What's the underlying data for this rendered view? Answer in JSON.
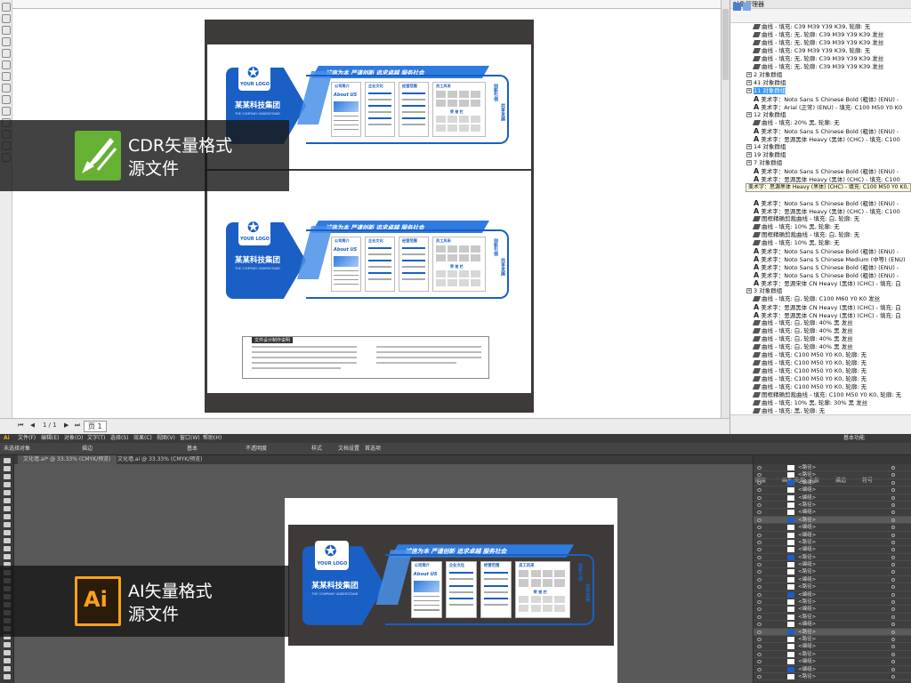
{
  "cdr": {
    "panel_title": "对象管理器",
    "page_tab": "页 1",
    "page_counter": "1 / 1",
    "tooltip": "美术字：思源黑体 Heavy (黑体) (CHC) - 填充: C100 M50 Y0 K0, 轮...",
    "tree": [
      {
        "t": "曲线 - 填充: C39 M39 Y39 K39, 轮廓: 无",
        "k": "curve"
      },
      {
        "t": "曲线 - 填充: 无, 轮廓: C39 M39 Y39 K39 发丝",
        "k": "curve"
      },
      {
        "t": "曲线 - 填充: 无, 轮廓: C39 M39 Y39 K39 发丝",
        "k": "curve"
      },
      {
        "t": "曲线 - 填充: C39 M39 Y39 K39, 轮廓: 无",
        "k": "curve"
      },
      {
        "t": "曲线 - 填充: 无, 轮廓: C39 M39 Y39 K39 发丝",
        "k": "curve"
      },
      {
        "t": "曲线 - 填充: 无, 轮廓: C39 M39 Y39 K39 发丝",
        "k": "curve"
      },
      {
        "t": "2 对象群组",
        "k": "group"
      },
      {
        "t": "41 对象群组",
        "k": "group"
      },
      {
        "t": "11 对象群组",
        "k": "group",
        "sel": true
      },
      {
        "t": "美术字：Noto Sans S Chinese Bold (粗体) (ENU) -",
        "k": "text"
      },
      {
        "t": "美术字：Arial (正常) (ENU) - 填充: C100 M50 Y0 K0",
        "k": "text"
      },
      {
        "t": "12 对象群组",
        "k": "group"
      },
      {
        "t": "曲线 - 填充: 20% 黑, 轮廓: 无",
        "k": "curve"
      },
      {
        "t": "美术字：Noto Sans S Chinese Bold (粗体) (ENU) -",
        "k": "text"
      },
      {
        "t": "美术字：思源黑体 Heavy (黑体) (CHC) - 填充: C100",
        "k": "text"
      },
      {
        "t": "14 对象群组",
        "k": "group"
      },
      {
        "t": "19 对象群组",
        "k": "group"
      },
      {
        "t": "7 对象群组",
        "k": "group"
      },
      {
        "t": "美术字：Noto Sans S Chinese Bold (粗体) (ENU) -",
        "k": "text"
      },
      {
        "t": "美术字：思源黑体 Heavy (黑体) (CHC) - 填充: C100",
        "k": "text"
      },
      {
        "t": "美术字：Noto Sans S Chinese Bold (粗体) (ENU) -",
        "k": "text"
      },
      {
        "t": "",
        "k": "tooltip"
      },
      {
        "t": "美术字：Noto Sans S Chinese Bold (粗体) (ENU) -",
        "k": "text"
      },
      {
        "t": "美术字：思源黑体 Heavy (黑体) (CHC) - 填充: C100",
        "k": "text"
      },
      {
        "t": "图框精确剪裁曲线 - 填充: 白, 轮廓: 无",
        "k": "curve"
      },
      {
        "t": "曲线 - 填充: 10% 黑, 轮廓: 无",
        "k": "curve"
      },
      {
        "t": "图框精确剪裁曲线 - 填充: 白, 轮廓: 无",
        "k": "curve"
      },
      {
        "t": "曲线 - 填充: 10% 黑, 轮廓: 无",
        "k": "curve"
      },
      {
        "t": "美术字：Noto Sans S Chinese Bold (粗体) (ENU) -",
        "k": "text"
      },
      {
        "t": "美术字：Noto Sans S Chinese Medium (中等) (ENU)",
        "k": "text"
      },
      {
        "t": "美术字：Noto Sans S Chinese Bold (粗体) (ENU) -",
        "k": "text"
      },
      {
        "t": "美术字：Noto Sans S Chinese Bold (粗体) (ENU) -",
        "k": "text"
      },
      {
        "t": "美术字：思源宋体 CN Heavy (黑体) (CHC) - 填充: 白",
        "k": "text"
      },
      {
        "t": "3 对象群组",
        "k": "group"
      },
      {
        "t": "曲线 - 填充: 白, 轮廓: C100 M60 Y0 K0 发丝",
        "k": "curve"
      },
      {
        "t": "美术字：思源黑体 CN Heavy (黑体) (CHC) - 填充: 白",
        "k": "text"
      },
      {
        "t": "美术字：思源黑体 CN Heavy (黑体) (CHC) - 填充: 白",
        "k": "text"
      },
      {
        "t": "曲线 - 填充: 白, 轮廓: 40% 黑 发丝",
        "k": "curve"
      },
      {
        "t": "曲线 - 填充: 白, 轮廓: 40% 黑 发丝",
        "k": "curve"
      },
      {
        "t": "曲线 - 填充: 白, 轮廓: 40% 黑 发丝",
        "k": "curve"
      },
      {
        "t": "曲线 - 填充: 白, 轮廓: 40% 黑 发丝",
        "k": "curve"
      },
      {
        "t": "曲线 - 填充: C100 M50 Y0 K0, 轮廓: 无",
        "k": "curve"
      },
      {
        "t": "曲线 - 填充: C100 M50 Y0 K0, 轮廓: 无",
        "k": "curve"
      },
      {
        "t": "曲线 - 填充: C100 M50 Y0 K0, 轮廓: 无",
        "k": "curve"
      },
      {
        "t": "曲线 - 填充: C100 M50 Y0 K0, 轮廓: 无",
        "k": "curve"
      },
      {
        "t": "曲线 - 填充: C100 M50 Y0 K0, 轮廓: 无",
        "k": "curve"
      },
      {
        "t": "图框精确剪裁曲线 - 填充: C100 M50 Y0 K0, 轮廓: 无",
        "k": "curve"
      },
      {
        "t": "曲线 - 填充: 10% 黑, 轮廓: 30% 黑 发丝",
        "k": "curve"
      },
      {
        "t": "曲线 - 填充: 黑, 轮廓: 无",
        "k": "curve"
      },
      {
        "t": "曲线 - 填充: 白, 轮廓: 无",
        "k": "curve"
      }
    ]
  },
  "banners": {
    "cdr_line1": "CDR矢量格式",
    "cdr_line2": "源文件",
    "ai_line1": "AI矢量格式",
    "ai_line2": "源文件",
    "ai_logo": "Ai"
  },
  "design": {
    "slogan": "诚信为本 严谨创新 追求卓越 服务社会",
    "company": "某某科技集团",
    "logo_text": "YOUR LOGO",
    "about_en": "About US",
    "col1": "公司简介",
    "col2": "企业文化",
    "col3": "经营范围",
    "col4": "员工风采",
    "side1": "创新引领",
    "side2": "共享发展",
    "honor": "荣 誉 栏",
    "company_en": "THE COMPANY UNDERSTAND",
    "notes_title": "文件设计制作说明"
  },
  "ai": {
    "menu": [
      "Ai",
      "文件(F)",
      "编辑(E)",
      "对象(O)",
      "文字(T)",
      "选择(S)",
      "效果(C)",
      "视图(V)",
      "窗口(W)",
      "帮助(H)"
    ],
    "workspace": "基本功能",
    "ctrl_left": "未选择对象",
    "ctrl_items": [
      "描边",
      "基本",
      "不透明度",
      "样式",
      "文档设置",
      "首选项"
    ],
    "tab1": "文化墙.ai* @ 33.33% (CMYK/预览)",
    "tab2": "文化墙.ai @ 33.33% (CMYK/预览)",
    "rtabs": [
      "图层",
      "画板/外观",
      "色板",
      "描边",
      "符号"
    ],
    "layer_names": [
      "<路径>",
      "<路径>",
      "<编组>",
      "<编组>",
      "<编组>",
      "<路径>",
      "<编组>",
      "<路径>",
      "<编组>",
      "<编组>",
      "<路径>",
      "<编组>",
      "<路径>",
      "<编组>",
      "<路径>",
      "<编组>",
      "<路径>",
      "<编组>",
      "<路径>",
      "<编组>",
      "<路径>",
      "<编组>",
      "<路径>",
      "<路径>",
      "<编组>",
      "<路径>",
      "<编组>",
      "<编组>",
      "<路径>"
    ]
  },
  "colors": {
    "brand_blue": "#1a5fc4",
    "cdr_green": "#66b034",
    "ai_orange": "#f7a21b",
    "page_dark": "#3e3a39"
  }
}
